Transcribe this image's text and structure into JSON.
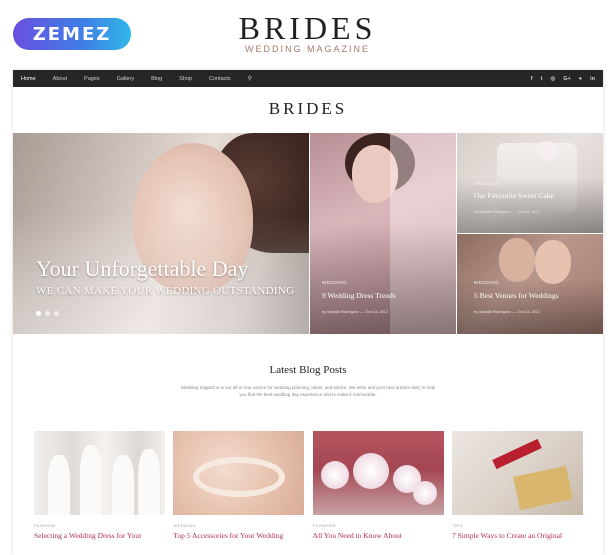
{
  "promo": {
    "brand_logo": "ZEMEZ",
    "title": "BRIDES",
    "subtitle": "WEDDING MAGAZINE"
  },
  "nav": {
    "items": [
      "Home",
      "About",
      "Pages",
      "Gallery",
      "Blog",
      "Shop",
      "Contacts"
    ],
    "active": "Home",
    "social": [
      "f",
      "t",
      "◎",
      "G+",
      "●",
      "in"
    ]
  },
  "site": {
    "logo_title": "BRIDES",
    "logo_sub": ""
  },
  "hero": {
    "main": {
      "title": "Your Unforgettable Day",
      "subtitle": "WE CAN MAKE YOUR WEDDING OUTSTANDING"
    },
    "slider_dots": 3,
    "tiles": [
      {
        "category": "WEDDING",
        "title": "9 Wedding Dress Trends",
        "meta": "by Natalie Rodriguez — Oct 14, 2017"
      },
      {
        "category": "WEDDING",
        "title": "Our Favourite Sweet Cake",
        "meta": "by Natalie Rodriguez — Oct 14, 2017"
      },
      {
        "category": "WEDDING",
        "title": "5 Best Venues for Weddings",
        "meta": "by Natalie Rodriguez — Oct 14, 2017"
      }
    ]
  },
  "blog": {
    "heading": "Latest Blog Posts",
    "description": "Wedding magazine is our all-in-one source for wedding planning, ideas, and advice. We write and post new articles daily to help you find the best wedding day experience and to make it memorable.",
    "posts": [
      {
        "category": "FASHION",
        "title": "Selecting a Wedding Dress for Your"
      },
      {
        "category": "WEDDING",
        "title": "Top 5 Accessories for Your Wedding"
      },
      {
        "category": "FLOWERS",
        "title": "All You Need to Know About"
      },
      {
        "category": "TIPS",
        "title": "7 Simple Ways to Create an Original"
      }
    ]
  },
  "colors": {
    "accent": "#b42c55",
    "navbar": "#262626",
    "logo_gradient_start": "#6a4fe0",
    "logo_gradient_end": "#2fb8e8"
  },
  "icons": {
    "search": "search-icon"
  }
}
